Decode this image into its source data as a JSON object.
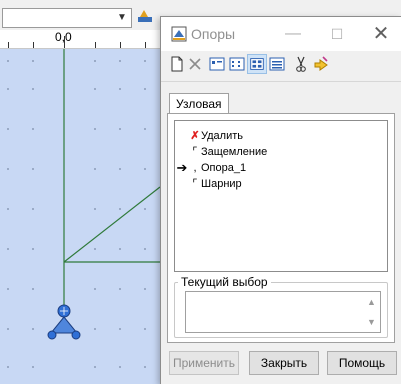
{
  "workspace": {
    "ruler_label": "0,0",
    "colors": {
      "canvas": "#c8d8f4",
      "grid_line": "#2f7a3a",
      "node": "#2f6fd6"
    }
  },
  "dialog": {
    "title": "Опоры",
    "toolbar": {
      "icons": [
        "new-icon",
        "delete-icon",
        "view-details-icon",
        "view-list-icon",
        "view-large-icon",
        "view-small-icon",
        "cut-icon",
        "rename-icon"
      ]
    },
    "tab": {
      "label": "Узловая"
    },
    "list": {
      "items": [
        {
          "label": "Удалить",
          "icon": "red-x-icon"
        },
        {
          "label": "Защемление",
          "icon": "fixed-support-icon"
        },
        {
          "label": "Опора_1",
          "icon": "support-icon",
          "current": true
        },
        {
          "label": "Шарнир",
          "icon": "hinge-icon"
        }
      ]
    },
    "selection": {
      "label": "Текущий выбор",
      "value": ""
    },
    "buttons": {
      "apply": "Применить",
      "close": "Закрыть",
      "help": "Помощь"
    }
  }
}
